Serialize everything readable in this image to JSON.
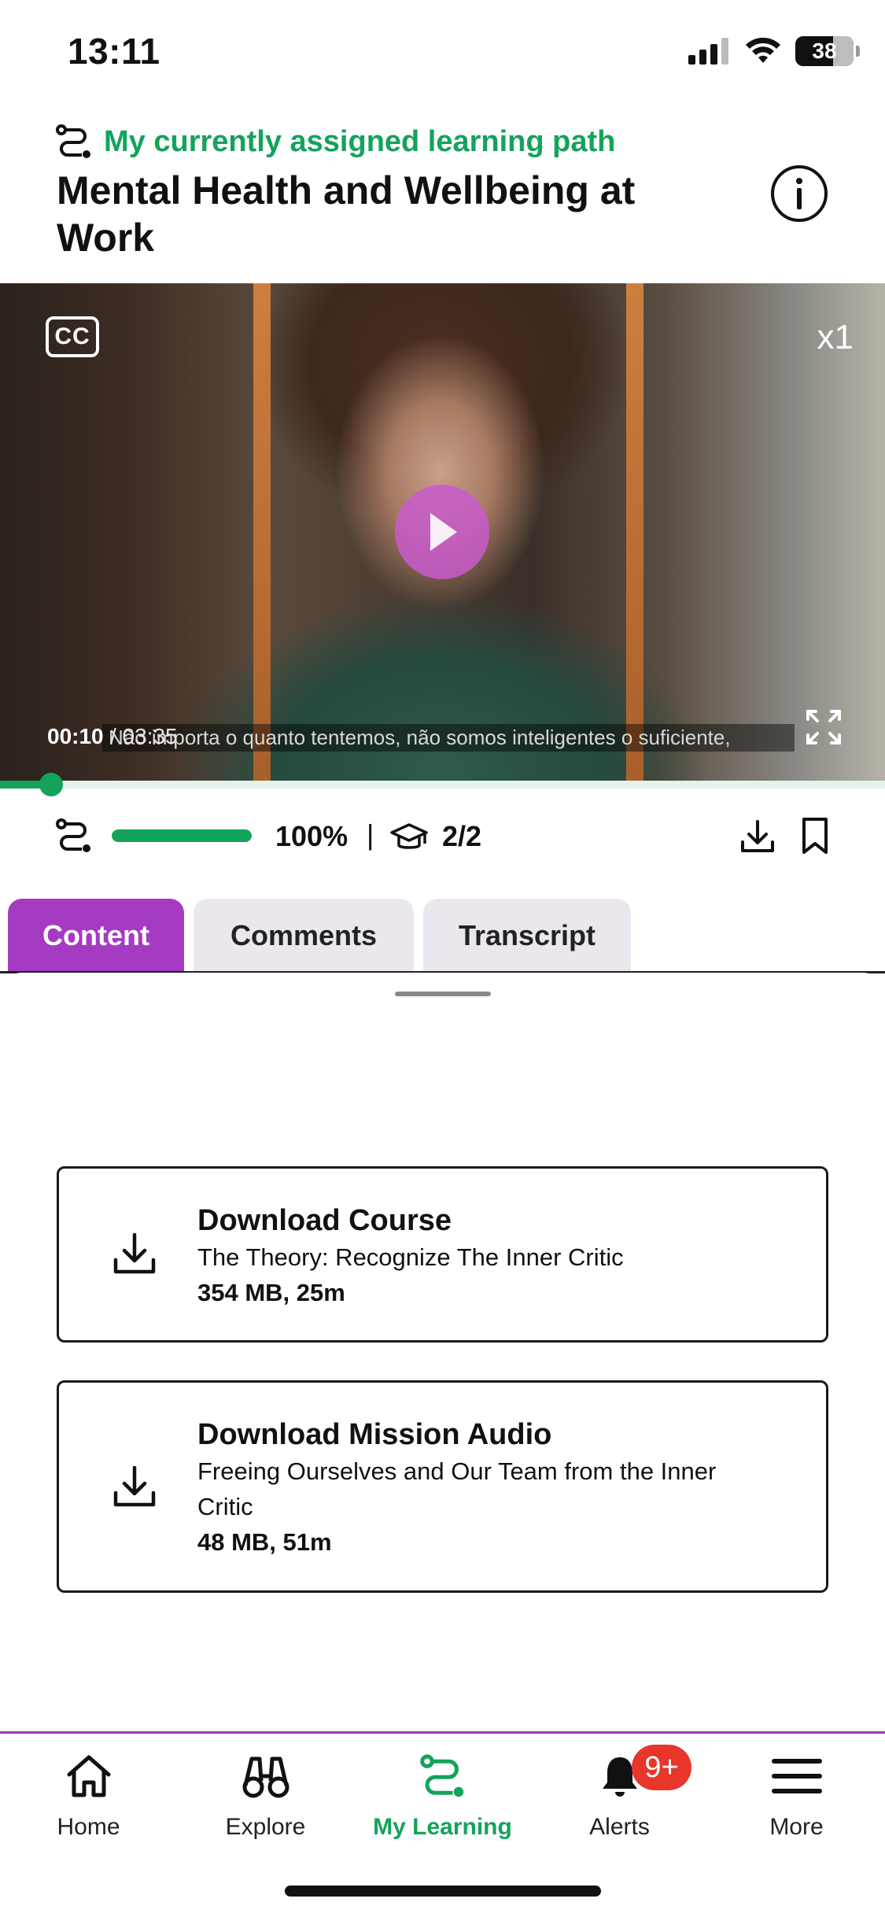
{
  "status_bar": {
    "time": "13:11",
    "battery": "38"
  },
  "header": {
    "path_label": "My currently assigned learning path",
    "title": "Mental Health and Wellbeing at Work"
  },
  "video": {
    "cc_label": "CC",
    "speed": "x1",
    "current_time": "00:10",
    "total_time": "/ 03:35",
    "subtitle": "Não importa o quanto tentemos, não somos inteligentes o suficiente,",
    "progress_fraction": 0.058
  },
  "stats": {
    "progress_fraction": 1.0,
    "progress_percent": "100%",
    "separator": "|",
    "modules": "2/2"
  },
  "tabs": [
    {
      "label": "Content",
      "active": true
    },
    {
      "label": "Comments",
      "active": false
    },
    {
      "label": "Transcript",
      "active": false
    }
  ],
  "downloads": [
    {
      "title": "Download Course",
      "subtitle": "The Theory: Recognize The Inner Critic",
      "meta": "354 MB, 25m"
    },
    {
      "title": "Download Mission Audio",
      "subtitle": "Freeing Ourselves and Our Team from the Inner Critic",
      "meta": "48 MB, 51m"
    }
  ],
  "bottom_nav": [
    {
      "label": "Home",
      "icon": "home-icon"
    },
    {
      "label": "Explore",
      "icon": "binoculars-icon"
    },
    {
      "label": "My Learning",
      "icon": "learning-path-icon",
      "active": true
    },
    {
      "label": "Alerts",
      "icon": "bell-icon",
      "badge": "9+"
    },
    {
      "label": "More",
      "icon": "menu-icon"
    }
  ],
  "colors": {
    "brand_green": "#13a35a",
    "accent_purple": "#a53bc3",
    "badge_red": "#e8362a"
  }
}
